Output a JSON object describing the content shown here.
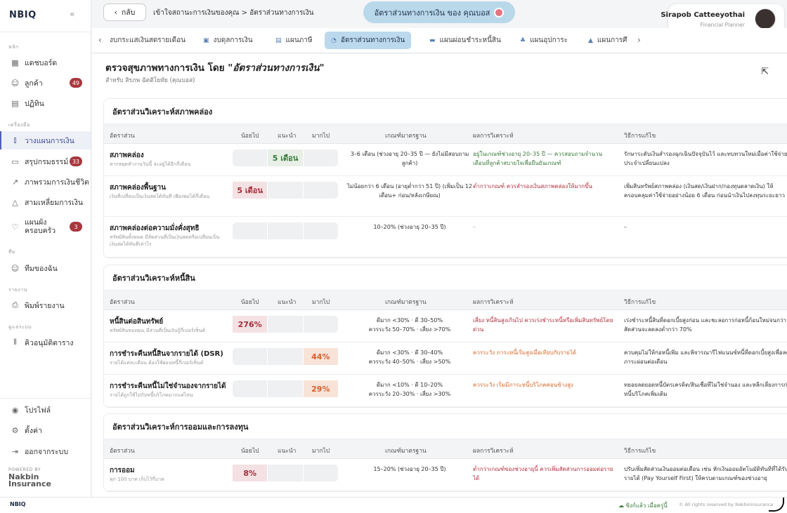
{
  "sidebar": {
    "brand": "NBIQ",
    "collapse_icon": "«",
    "sections": {
      "main": "หลัก",
      "tools": "เครื่องมือ",
      "team": "ทีม",
      "reports": "รายงาน",
      "system": "ดูแลระบบ"
    },
    "items": [
      {
        "label": "แดชบอร์ด",
        "icon": "dashboard-icon"
      },
      {
        "label": "ลูกค้า",
        "icon": "users-icon",
        "badge": "49"
      },
      {
        "label": "ปฏิทิน",
        "icon": "calendar-icon"
      },
      {
        "label": "วางแผนการเงิน",
        "icon": "chart-icon",
        "active": true
      },
      {
        "label": "สรุปกรมธรรม์",
        "icon": "document-icon",
        "badge": "33"
      },
      {
        "label": "ภาพรวมการเงินชีวิต",
        "icon": "trend-icon"
      },
      {
        "label": "สามเหลี่ยมการเงิน",
        "icon": "triangle-icon"
      },
      {
        "label": "แผนผัง\nครอบครัว",
        "icon": "heart-icon",
        "badge": "3"
      },
      {
        "label": "ทีมของฉัน",
        "icon": "team-icon"
      },
      {
        "label": "พิมพ์รายงาน",
        "icon": "print-icon"
      },
      {
        "label": "คิวอนุมัติตาราง",
        "icon": "queue-icon"
      }
    ],
    "bottom": [
      {
        "label": "โปรไฟล์",
        "icon": "profile-icon"
      },
      {
        "label": "ตั้งค่า",
        "icon": "settings-icon"
      },
      {
        "label": "ออกจากระบบ",
        "icon": "logout-icon"
      }
    ],
    "powered_by": "POWERED BY",
    "powered_logo": "Nakbin Insurance"
  },
  "topbar": {
    "back_label": "กลับ",
    "breadcrumb": "เข้าใจสถานะการเงินของคุณ > อัตราส่วนทางการเงิน",
    "pill_text": "อัตราส่วนทางการเงิน ของ คุณบอส",
    "user_name": "Sirapob Catteeyothai",
    "user_role": "Financial Planner"
  },
  "tabs": [
    {
      "label": "งบกระแสเงินสดรายเดือน",
      "icon": ""
    },
    {
      "label": "งบดุลการเงิน",
      "icon": "balance-icon"
    },
    {
      "label": "แผนภาษี",
      "icon": "tax-icon"
    },
    {
      "label": "อัตราส่วนทางการเงิน",
      "icon": "ratio-icon",
      "active": true
    },
    {
      "label": "แผนผ่อนชำระหนี้สิน",
      "icon": "debt-icon"
    },
    {
      "label": "แผนอุปการะ",
      "icon": "family-icon"
    },
    {
      "label": "แผนการศึ",
      "icon": "education-icon"
    }
  ],
  "page": {
    "title_prefix": "ตรวจสุขภาพทางการเงิน โดย",
    "title_em": "\"อัตราส่วนทางการเงิน\"",
    "subtitle": "สำหรับ สิรภพ ฉัตติโยทัย (คุณบอส)"
  },
  "columns": {
    "ratio": "อัตราส่วน",
    "low": "น้อยไป",
    "ok": "แนะนำ",
    "high": "มากไป",
    "std": "เกณฑ์มาตรฐาน",
    "result": "ผลการวิเคราะห์",
    "fix": "วิธีการแก้ไข"
  },
  "cards": [
    {
      "title": "อัตราส่วนวิเคราะห์สภาพคล่อง",
      "rows": [
        {
          "name": "สภาพคล่อง",
          "desc": "หากหยุดทำงานวันนี้ จะอยู่ได้อีกกี่เดือน",
          "value": "5 เดือน",
          "pos": 1,
          "tone": "green",
          "std": "3–6 เดือน (ช่วงอายุ 20–35 ปี — ยังไม่มีสอบถามลูกค้า)",
          "result": "อยู่ในเกณฑ์ช่วงอายุ 20–35 ปี — ควรสอบถามจำนวนเดือนที่ลูกค้าสบายใจเพื่อยืนยันเกณฑ์",
          "result_tone": "green",
          "fix": "รักษาระดับเงินสำรองฉุกเฉินปัจจุบันไว้ และทบทวนใหม่เมื่อค่าใช้จ่ายประจำเปลี่ยนแปลง"
        },
        {
          "name": "สภาพคล่องพื้นฐาน",
          "desc": "เงินที่เปลี่ยนเป็นเงินสดได้ทันที เพียงพอได้กี่เดือน",
          "value": "5 เดือน",
          "pos": 0,
          "tone": "red",
          "std": "ไม่น้อยกว่า 6 เดือน (อายุต่ำกว่า 51 ปี) (เพิ่มเป็น 12 เดือน+ ก่อน/หลังเกษียณ)",
          "result": "ต่ำกว่าเกณฑ์ ควรสำรองเงินสภาพคล่องให้มากขึ้น",
          "result_tone": "red",
          "fix": "เพิ่มสินทรัพย์สภาพคล่อง (เงินสด/เงินฝาก/กองทุนตลาดเงิน) ให้ครอบคลุมค่าใช้จ่ายอย่างน้อย 6 เดือน ก่อนนำเงินไปลงทุนระยะยาว"
        },
        {
          "name": "สภาพคล่องต่อความมั่งคั่งสุทธิ",
          "desc": "ทรัพย์สินทั้งหมด มีสัดส่วนที่เป็นเงินสดหรือเปลี่ยนเป็นเงินสดได้ทันทีเท่าไร",
          "value": "",
          "pos": -1,
          "tone": "",
          "std": "10–20% (ช่วงอายุ 20–35 ปี)",
          "result": "–",
          "result_tone": "gray",
          "fix": "–"
        }
      ]
    },
    {
      "title": "อัตราส่วนวิเคราะห์หนี้สิน",
      "rows": [
        {
          "name": "หนี้สินต่อสินทรัพย์",
          "desc": "ทรัพย์สินของคุณ มีส่วนที่เป็นเงินกู้กี่เปอร์เซ็นต์",
          "value": "276%",
          "pos": 0,
          "tone": "red",
          "std": "ดีมาก <30% · ดี 30–50%\nควรระวัง 50–70% · เสี่ยง >70%",
          "result": "เสี่ยง หนี้สินสูงเกินไป ควรเร่งชำระหนี้หรือเพิ่มสินทรัพย์โดยด่วน",
          "result_tone": "red",
          "fix": "เร่งชำระหนี้สินที่ดอกเบี้ยสูงก่อน และชะลอการก่อหนี้ก้อนใหม่จนกว่าสัดส่วนจะลดลงต่ำกว่า 70%"
        },
        {
          "name": "การชำระคืนหนี้สินจากรายได้ (DSR)",
          "desc": "รายได้แต่ละเดือน ต้องใช้ผ่อนหนี้กี่เปอร์เซ็นต์",
          "value": "44%",
          "pos": 2,
          "tone": "orange",
          "std": "ดีมาก <30% · ดี 30–40%\nควรระวัง 40–50% · เสี่ยง >50%",
          "result": "ควรระวัง ภาระหนี้เริ่มสูงเมื่อเทียบกับรายได้",
          "result_tone": "orange",
          "fix": "ควบคุมไม่ให้ก่อหนี้เพิ่ม และพิจารณารีไฟแนนซ์หนี้ที่ดอกเบี้ยสูงเพื่อลดภาระผ่อนต่อเดือน"
        },
        {
          "name": "การชำระคืนหนี้ไม่ใช่จำนองจากรายได้",
          "desc": "รายได้ถูกใช้ไปกับหนี้บริโภคมากแค่ไหน",
          "value": "29%",
          "pos": 2,
          "tone": "orange",
          "std": "ดีมาก <10% · ดี 10–20%\nควรระวัง 20–30% · เสี่ยง >30%",
          "result": "ควรระวัง เริ่มมีภาระหนี้บริโภคค่อนข้างสูง",
          "result_tone": "orange",
          "fix": "ทยอยลดยอดหนี้บัตรเครดิต/สินเชื่อที่ไม่ใช่จำนอง และหลีกเลี่ยงการก่อหนี้บริโภคเพิ่มเติม"
        }
      ]
    },
    {
      "title": "อัตราส่วนวิเคราะห์การออมและการลงทุน",
      "rows": [
        {
          "name": "การออม",
          "desc": "ทุก 100 บาท เก็บไว้กี่บาท",
          "value": "8%",
          "pos": 0,
          "tone": "red",
          "std": "15–20% (ช่วงอายุ 20–35 ปี)",
          "result": "ต่ำกว่าเกณฑ์ของช่วงอายุนี้ ควรเพิ่มสัดส่วนการออมต่อรายได้",
          "result_tone": "red",
          "fix": "ปรับเพิ่มสัดส่วนเงินออมต่อเดือน เช่น หักเงินออมอัตโนมัติทันทีที่ได้รับรายได้ (Pay Yourself First) ให้ครบตามเกณฑ์ของช่วงอายุ"
        }
      ]
    }
  ],
  "footer": {
    "brand": "NBIQ",
    "sync": "ซิงก์แล้ว เมื่อครู่นี้",
    "copyright": "© All rights reserved by Nakbininsurance"
  }
}
